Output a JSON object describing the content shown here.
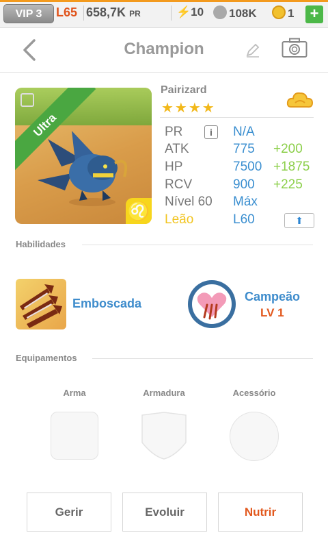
{
  "status_bar": {
    "vip": "VIP 3",
    "level": "L65",
    "power": "658,7K",
    "power_unit": "PR",
    "energy": "10",
    "silver": "108K",
    "gems": "1",
    "add": "+"
  },
  "header": {
    "title": "Champion"
  },
  "monster": {
    "name": "Pairizard",
    "rarity": "Ultra",
    "stars": "★★★★",
    "element_icon": "cloud-element-icon",
    "sign_glyph": "♌",
    "stats": [
      {
        "label": "PR",
        "value": "N/A",
        "bonus": ""
      },
      {
        "label": "ATK",
        "value": "775",
        "bonus": "+200"
      },
      {
        "label": "HP",
        "value": "7500",
        "bonus": "+1875"
      },
      {
        "label": "RCV",
        "value": "900",
        "bonus": "+225"
      },
      {
        "label": "Nível 60",
        "value": "Máx",
        "bonus": ""
      },
      {
        "label": "Leão",
        "value": "L60",
        "bonus": ""
      }
    ]
  },
  "skills": {
    "section_title": "Habilidades",
    "items": [
      {
        "name": "Emboscada"
      },
      {
        "name": "Campeão",
        "level": "LV 1"
      }
    ]
  },
  "equipment": {
    "section_title": "Equipamentos",
    "slots": [
      {
        "label": "Arma"
      },
      {
        "label": "Armadura"
      },
      {
        "label": "Acessório"
      }
    ]
  },
  "actions": {
    "manage": "Gerir",
    "evolve": "Evoluir",
    "feed": "Nutrir"
  },
  "colors": {
    "accent_blue": "#3b8fd0",
    "bonus_green": "#8ccf4a",
    "orange": "#e2581d",
    "leo_yellow": "#f2c522"
  }
}
